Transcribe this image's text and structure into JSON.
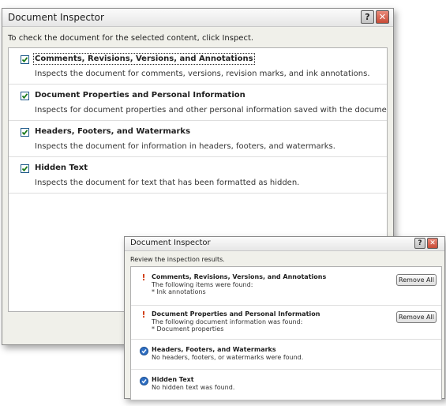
{
  "back_dialog": {
    "title": "Document Inspector",
    "help_glyph": "?",
    "close_glyph": "✕",
    "intro": "To check the document for the selected content, click Inspect.",
    "items": [
      {
        "title": "Comments, Revisions, Versions, and Annotations",
        "description": "Inspects the document for comments, versions, revision marks, and ink annotations.",
        "checked": true
      },
      {
        "title": "Document Properties and Personal Information",
        "description": "Inspects for document properties and other personal information saved with the document.",
        "checked": true
      },
      {
        "title": "Headers, Footers, and Watermarks",
        "description": "Inspects the document for information in headers, footers, and watermarks.",
        "checked": true
      },
      {
        "title": "Hidden Text",
        "description": "Inspects the document for text that has been formatted as hidden.",
        "checked": true
      }
    ]
  },
  "front_dialog": {
    "title": "Document Inspector",
    "help_glyph": "?",
    "close_glyph": "✕",
    "intro": "Review the inspection results.",
    "results": [
      {
        "status": "issue",
        "title": "Comments, Revisions, Versions, and Annotations",
        "line1": "The following items were found:",
        "line2": "* Ink annotations",
        "button": "Remove All"
      },
      {
        "status": "issue",
        "title": "Document Properties and Personal Information",
        "line1": "The following document information was found:",
        "line2": "* Document properties",
        "button": "Remove All"
      },
      {
        "status": "ok",
        "title": "Headers, Footers, and Watermarks",
        "line1": "No headers, footers, or watermarks were found."
      },
      {
        "status": "ok",
        "title": "Hidden Text",
        "line1": "No hidden text was found."
      }
    ]
  },
  "colors": {
    "issue": "#d03a12",
    "ok": "#2e6fc4",
    "close": "#c84b36"
  },
  "icons": {
    "issue": "exclamation-icon",
    "ok": "checkmark-circle-icon",
    "checkbox": "checkbox-checked-icon"
  }
}
